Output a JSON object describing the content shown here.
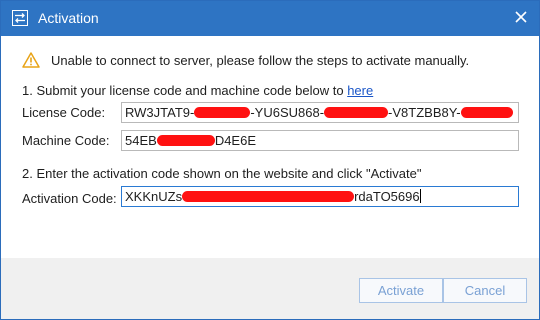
{
  "window": {
    "title": "Activation",
    "title_bar_color": "#2e74c3"
  },
  "icons": {
    "title": "activation-arrows-icon",
    "close": "close-icon",
    "warning": "warning-icon"
  },
  "message": {
    "warning": "Unable to connect to server, please follow the steps to activate manually."
  },
  "step1": {
    "text": "1. Submit your license code and machine code below to ",
    "link": "here"
  },
  "license": {
    "label": "License Code:",
    "seg1": "RW3JTAT9-",
    "seg2": "-YU6SU868-",
    "seg3": "-V8TZBB8Y-"
  },
  "machine": {
    "label": "Machine Code:",
    "seg1": "54EB",
    "seg2": "D4E6E"
  },
  "step2": {
    "text": "2. Enter the activation code shown on the website and click \"Activate\""
  },
  "activation": {
    "label": "Activation Code:",
    "seg1": "XKKnUZs",
    "seg2": "rdaTO5696"
  },
  "buttons": {
    "activate": "Activate",
    "cancel": "Cancel"
  },
  "colors": {
    "redaction": "#ff1111",
    "link": "#1a56c8",
    "warning": "#e8a317"
  }
}
